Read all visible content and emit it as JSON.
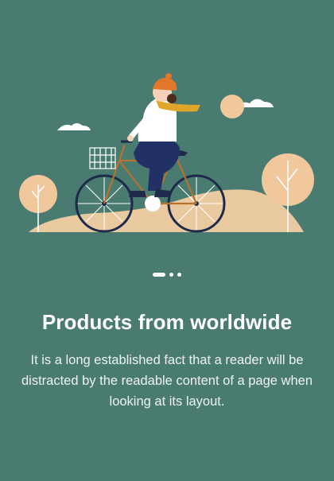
{
  "onboarding": {
    "title": "Products from worldwide",
    "description": "It is a long established fact that a reader will be distracted by the readable content of a page when looking at its layout.",
    "illustration_icon": "woman-riding-bicycle-illustration"
  },
  "pager": {
    "total_pages": 3,
    "active_index": 0
  },
  "colors": {
    "background": "#4a7b70",
    "hill": "#e8c9a0",
    "tree": "#f1c89c",
    "bike_frame": "#b6722f",
    "wheel": "#1d2a4a",
    "hat": "#e0772b",
    "scarf": "#e0a62a",
    "pants": "#223165",
    "sweater": "#ffffff"
  }
}
